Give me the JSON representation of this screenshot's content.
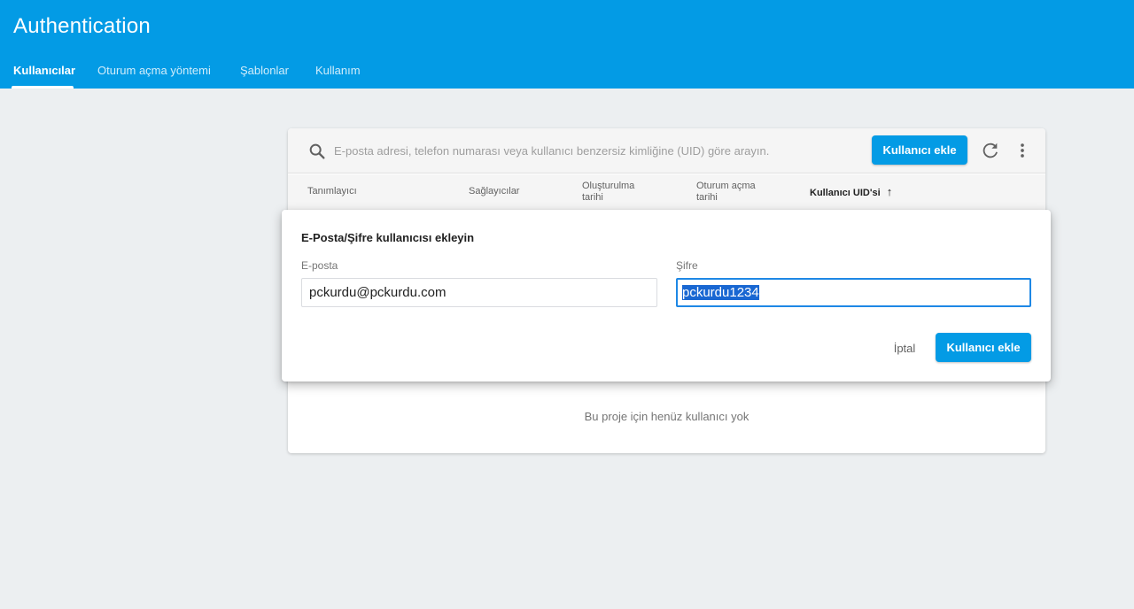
{
  "app": {
    "title": "Authentication"
  },
  "tabs": [
    {
      "label": "Kullanıcılar",
      "active": true
    },
    {
      "label": "Oturum açma yöntemi",
      "active": false
    },
    {
      "label": "Şablonlar",
      "active": false
    },
    {
      "label": "Kullanım",
      "active": false
    }
  ],
  "toolbar": {
    "search_placeholder": "E-posta adresi, telefon numarası veya kullanıcı benzersiz kimliğine (UID) göre arayın.",
    "add_user_label": "Kullanıcı ekle",
    "icons": {
      "search": "search-icon",
      "refresh": "refresh-icon",
      "more": "more-vert-icon"
    }
  },
  "table": {
    "columns": {
      "identifier": "Tanımlayıcı",
      "providers": "Sağlayıcılar",
      "created_line1": "Oluşturulma",
      "created_line2": "tarihi",
      "signed_in_line1": "Oturum açma",
      "signed_in_line2": "tarihi",
      "uid": "Kullanıcı UID'si"
    },
    "sort_indicator": "↑",
    "empty_message": "Bu proje için henüz kullanıcı yok"
  },
  "dialog": {
    "title": "E-Posta/Şifre kullanıcısı ekleyin",
    "email_label": "E-posta",
    "email_value": "pckurdu@pckurdu.com",
    "password_label": "Şifre",
    "password_value": "pckurdu1234",
    "cancel_label": "İptal",
    "submit_label": "Kullanıcı ekle"
  },
  "colors": {
    "brand": "#039be5",
    "background": "#eceff1",
    "focus": "#1e88e5"
  }
}
